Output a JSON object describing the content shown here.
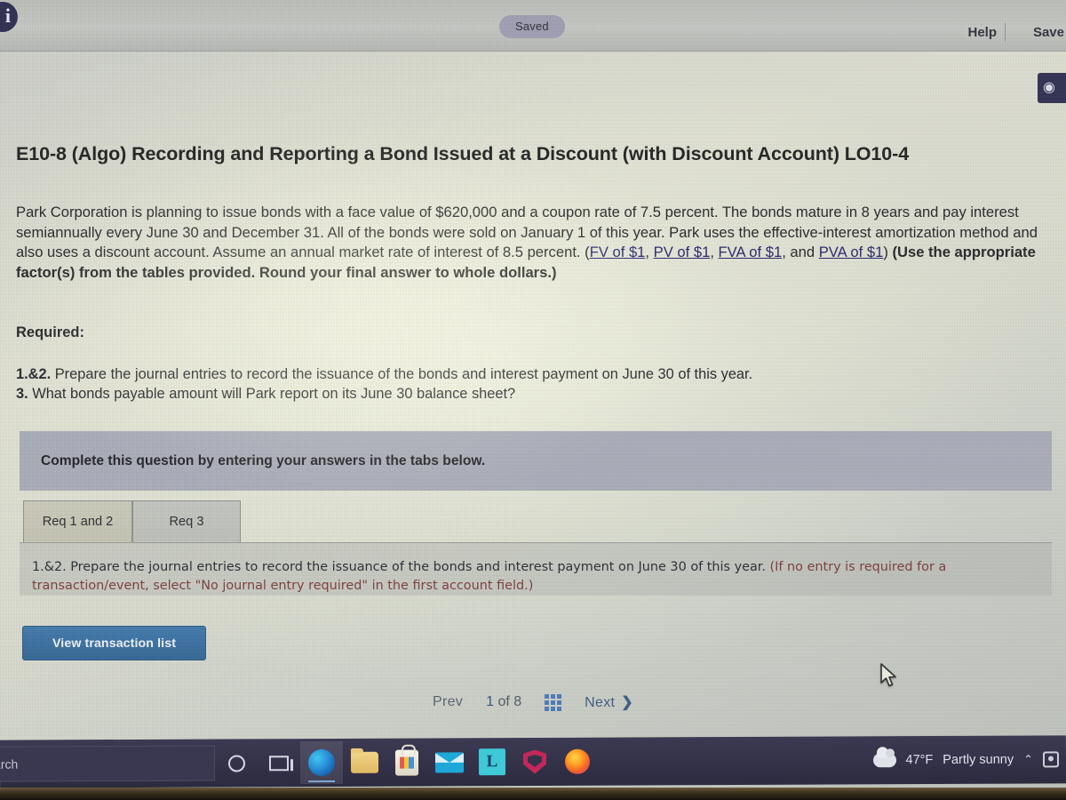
{
  "topbar": {
    "info_icon": "info-icon",
    "saved_badge": "Saved",
    "help_label": "Help",
    "save_label": "Save "
  },
  "question": {
    "title": "E10-8 (Algo) Recording and Reporting a Bond Issued at a Discount (with Discount Account) LO10-4",
    "prompt_part1": "Park Corporation is planning to issue bonds with a face value of $620,000 and a coupon rate of 7.5 percent. The bonds mature in 8 years and pay interest semiannually every June 30 and December 31. All of the bonds were sold on January 1 of this year. Park uses the effective-interest amortization method and also uses a discount account. Assume an annual market rate of interest of 8.5 percent. (",
    "link_fv": "FV of $1",
    "link_pv": "PV of $1",
    "link_fva": "FVA of $1",
    "link_pva": "PVA of $1",
    "prompt_sep1": ", ",
    "prompt_sep2": ", ",
    "prompt_sep3": ", and ",
    "prompt_tail": ") ",
    "prompt_bold": "(Use the appropriate factor(s) from the tables provided. Round your final answer to whole dollars.)",
    "required_label": "Required:",
    "req_1and2_num": "1.&2.",
    "req_1and2_text": " Prepare the journal entries to record the issuance of the bonds and interest payment on June 30 of this year.",
    "req_3_num": "3.",
    "req_3_text": " What bonds payable amount will Park report on its June 30 balance sheet?"
  },
  "panel": {
    "complete_text": "Complete this question by entering your answers in the tabs below."
  },
  "tabs": [
    {
      "label": "Req 1 and 2",
      "active": true
    },
    {
      "label": "Req 3",
      "active": false
    }
  ],
  "tab_content": {
    "instruction_main": "1.&2. Prepare the journal entries to record the issuance of the bonds and interest payment on June 30 of this year. ",
    "instruction_note": "(If no entry is required for a transaction/event, select \"No journal entry required\" in the first account field.)",
    "view_transaction_button": "View transaction list"
  },
  "pagination": {
    "prev_label": "Prev",
    "page_current": "1",
    "page_of": " of ",
    "page_total": "8",
    "grid_icon": "grid-icon",
    "next_label": "Next",
    "next_chevron": "❯"
  },
  "taskbar": {
    "search_text": "arch",
    "icons": [
      "cortana-icon",
      "task-view-icon",
      "edge-icon",
      "file-explorer-icon",
      "microsoft-store-icon",
      "mail-icon",
      "lockdown-browser-icon",
      "mcafee-icon",
      "firefox-icon"
    ],
    "lockdown_letter": "L",
    "weather_temp": "47°F",
    "weather_desc": "Partly sunny",
    "tray_chevron": "⌃"
  },
  "colors": {
    "accent_blue": "#3f77aa",
    "link_navy": "#23236a",
    "panel_gray": "#a8aab6",
    "badge_purple": "#9e9cb0",
    "note_red": "#7a3a3a",
    "taskbar_dark": "#343249"
  }
}
